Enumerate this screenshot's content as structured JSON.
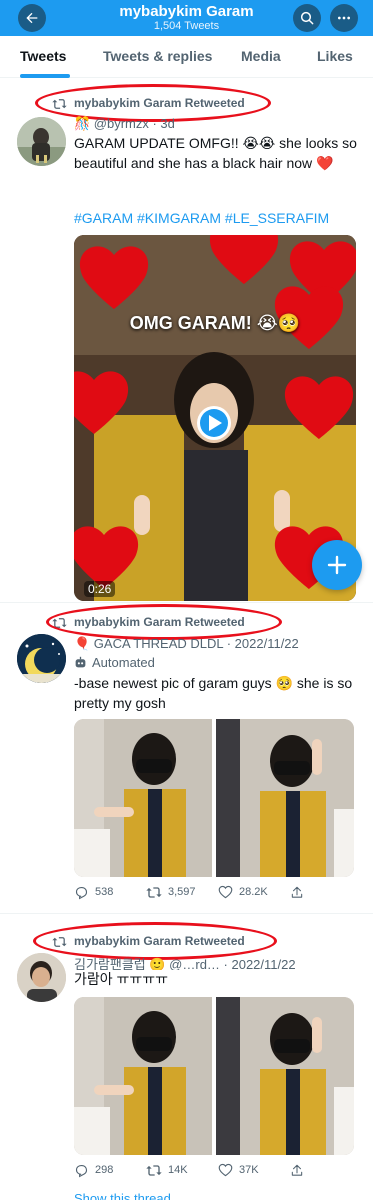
{
  "header": {
    "title": "mybabykim Garam",
    "subtitle": "1,504 Tweets",
    "back_icon": "back-arrow-icon",
    "search_icon": "search-icon",
    "more_icon": "more-icon"
  },
  "tabs": [
    {
      "label": "Tweets",
      "active": true
    },
    {
      "label": "Tweets & replies",
      "active": false
    },
    {
      "label": "Media",
      "active": false
    },
    {
      "label": "Likes",
      "active": false
    }
  ],
  "tweets": [
    {
      "retweeted_by": "mybabykim Garam Retweeted",
      "byline": "🎊 @byrmzx · 3d",
      "text": "GARAM UPDATE OMFG!! 😭😭 she looks so beautiful and she has a black hair now ❤️",
      "hashtags": "#GARAM #KIMGARAM #LE_SSERAFIM",
      "video": {
        "overlay_text": "OMG GARAM! 😭🥺",
        "duration": "0:26"
      }
    },
    {
      "retweeted_by": "mybabykim Garam Retweeted",
      "byline": "🎈 GACA THREAD DLDL · 2022/11/22",
      "badge": "Automated",
      "text": "-base newest pic of garam guys 🥺 she is so pretty my gosh",
      "stats": {
        "replies": "538",
        "retweets": "3,597",
        "likes": "28.2K"
      }
    },
    {
      "retweeted_by": "mybabykim Garam Retweeted",
      "byline": "김가람팬클럽 🙂 @…rd… · 2022/11/22",
      "text": "가람아 ㅠㅠㅠㅠ",
      "stats": {
        "replies": "298",
        "retweets": "14K",
        "likes": "37K"
      }
    }
  ],
  "footer_link": "Show this thread",
  "fab_icon": "compose-plus-icon",
  "colors": {
    "accent": "#1d9bf0",
    "highlight": "#e8101c",
    "muted": "#536471"
  }
}
